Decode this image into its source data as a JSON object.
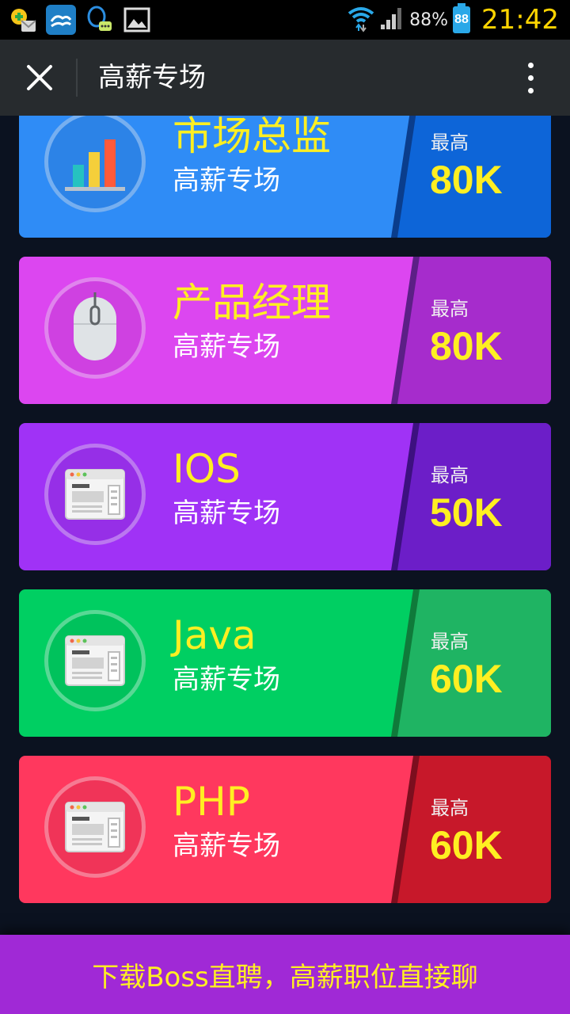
{
  "status_bar": {
    "battery_percent": "88%",
    "battery_level": "88",
    "time": "21:42"
  },
  "app_bar": {
    "title": "高薪专场"
  },
  "cards": [
    {
      "title": "市场总监",
      "subtitle": "高薪专场",
      "max_label": "最高",
      "max_value": "80K",
      "icon": "bar-chart-icon",
      "bg": "#2f8cf6",
      "band": "#0d65d8",
      "shade": "#0a3d8c"
    },
    {
      "title": "产品经理",
      "subtitle": "高薪专场",
      "max_label": "最高",
      "max_value": "80K",
      "icon": "mouse-icon",
      "bg": "#dc46f0",
      "band": "#a62ccc",
      "shade": "#5c1f86"
    },
    {
      "title": "IOS",
      "subtitle": "高薪专场",
      "max_label": "最高",
      "max_value": "50K",
      "icon": "browser-window-icon",
      "bg": "#a032f6",
      "band": "#6c1ec8",
      "shade": "#3d1080"
    },
    {
      "title": "Java",
      "subtitle": "高薪专场",
      "max_label": "最高",
      "max_value": "60K",
      "icon": "browser-window-icon",
      "bg": "#00cf62",
      "band": "#1fb463",
      "shade": "#0f7a3a"
    },
    {
      "title": "PHP",
      "subtitle": "高薪专场",
      "max_label": "最高",
      "max_value": "60K",
      "icon": "browser-window-icon",
      "bg": "#ff385e",
      "band": "#c7182a",
      "shade": "#7c0e1e"
    }
  ],
  "banner": {
    "text": "下载Boss直聘，高薪职位直接聊"
  }
}
